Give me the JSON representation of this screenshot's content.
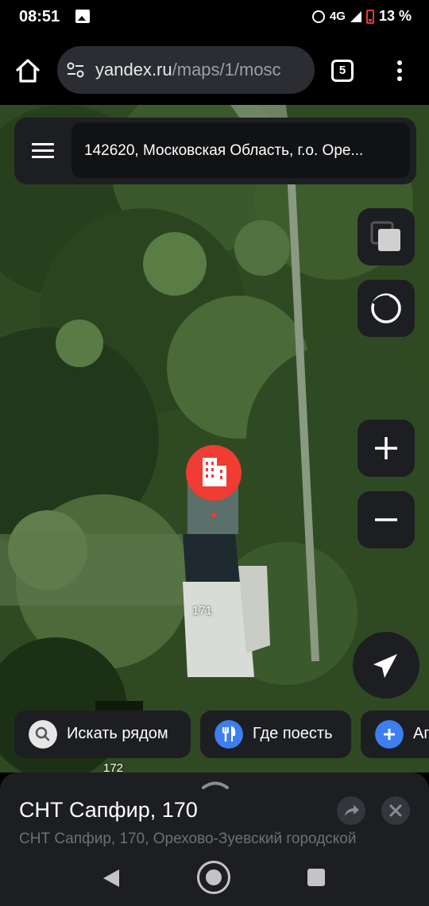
{
  "status_bar": {
    "time": "08:51",
    "network": "4G",
    "battery": "13 %",
    "icons": [
      "image-icon",
      "alarm-icon",
      "signal-icon",
      "battery-low-icon"
    ]
  },
  "browser": {
    "url_host": "yandex.ru",
    "url_path": "/maps/1/mosc",
    "tab_count": "5",
    "icons": [
      "home-icon",
      "site-settings-icon",
      "tabs-icon",
      "overflow-menu-icon"
    ]
  },
  "map": {
    "search_address": "142620, Московская Область, г.о. Оре...",
    "house_numbers": [
      "171",
      "172"
    ],
    "controls": [
      "layers-icon",
      "orbit-icon",
      "zoom-in-icon",
      "zoom-out-icon",
      "locate-icon"
    ],
    "pin_icon": "building-icon",
    "chips": [
      {
        "label": "Искать рядом",
        "icon": "search-icon",
        "icon_bg": "#e6e6e6"
      },
      {
        "label": "Где поесть",
        "icon": "fork-knife-icon",
        "icon_bg": "#3d7ef0"
      },
      {
        "label": "Ап",
        "icon": "plus-icon",
        "icon_bg": "#3d7ef0"
      }
    ]
  },
  "sheet": {
    "title": "СНТ Сапфир, 170",
    "subtitle": "СНТ Сапфир, 170, Орехово-Зуевский городской"
  },
  "colors": {
    "pin": "#f03c32",
    "accent_blue": "#3d7ef0",
    "panel": "#1d1e22"
  }
}
